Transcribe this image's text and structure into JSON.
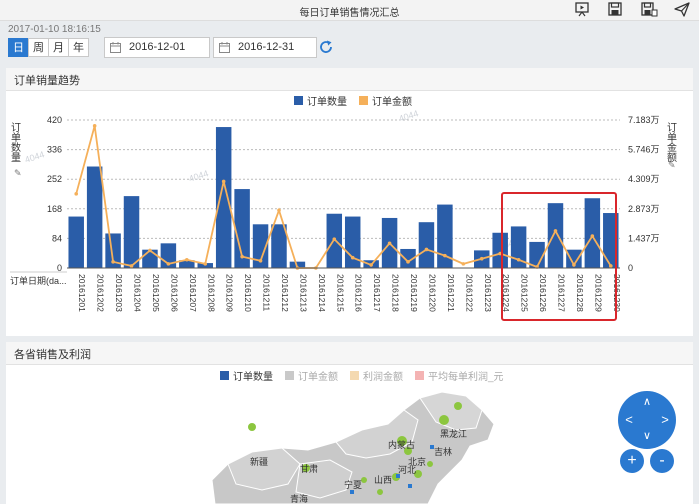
{
  "header": {
    "title": "每日订单销售情况汇总"
  },
  "toolbar": {
    "timestamp": "2017-01-10 18:16:15"
  },
  "period_buttons": [
    "日",
    "周",
    "月",
    "年"
  ],
  "date_range": {
    "start": "2016-12-01",
    "end": "2016-12-31"
  },
  "trend_panel": {
    "title": "订单销量趋势"
  },
  "chart_data": {
    "type": "bar",
    "legend": [
      "订单数量",
      "订单金额"
    ],
    "legend_position": "top",
    "ylabel_left": "订单数量",
    "ylabel_right": "订单金额",
    "xlabel": "订单日期(da...",
    "yticks_left": [
      "420",
      "336",
      "252",
      "168",
      "84",
      "0"
    ],
    "yticks_right": [
      "7.183万",
      "5.746万",
      "4.309万",
      "2.873万",
      "1.437万",
      "0"
    ],
    "ylim_left": [
      0,
      420
    ],
    "ylim_right": [
      0,
      7.183
    ],
    "categories": [
      "20161201",
      "20161202",
      "20161203",
      "20161204",
      "20161205",
      "20161206",
      "20161207",
      "20161208",
      "20161209",
      "20161210",
      "20161211",
      "20161212",
      "20161213",
      "20161214",
      "20161215",
      "20161216",
      "20161217",
      "20161218",
      "20161219",
      "20161220",
      "20161221",
      "20161222",
      "20161223",
      "20161224",
      "20161225",
      "20161226",
      "20161227",
      "20161228",
      "20161229",
      "20161230"
    ],
    "series": [
      {
        "name": "订单数量",
        "type": "bar",
        "axis": "left",
        "color": "#2a5da8",
        "values": [
          146,
          288,
          98,
          204,
          52,
          70,
          22,
          14,
          400,
          224,
          124,
          124,
          18,
          0,
          154,
          146,
          22,
          142,
          54,
          130,
          180,
          0,
          50,
          100,
          118,
          74,
          184,
          52,
          198,
          156
        ]
      },
      {
        "name": "订单金额",
        "type": "line",
        "axis": "right",
        "color": "#f5b05a",
        "values": [
          3.6,
          6.9,
          0.3,
          0.1,
          0.85,
          0.2,
          0.4,
          0.2,
          4.2,
          0.55,
          0.35,
          2.8,
          0.0,
          0.0,
          1.4,
          0.5,
          0.15,
          1.2,
          0.3,
          0.9,
          0.6,
          0.2,
          0.45,
          0.7,
          0.4,
          0.05,
          1.8,
          0.15,
          1.55,
          0.1
        ]
      }
    ],
    "grid": true
  },
  "province_panel": {
    "title": "各省销售及利润",
    "legend": [
      "订单数量",
      "订单金额",
      "利润金额",
      "平均每单利润_元"
    ],
    "legend_colors": [
      "#2a5da8",
      "#c9c9c9",
      "#f4d9b0",
      "#f4b3b3"
    ],
    "labels": [
      "黑龙江",
      "内蒙古",
      "吉林",
      "新疆",
      "甘肃",
      "宁夏",
      "山西",
      "河北",
      "北京",
      "青海"
    ]
  },
  "map_nav": {
    "up": "∧",
    "down": "∨",
    "left": "<",
    "right": ">",
    "zoom_in": "+",
    "zoom_out": "-"
  },
  "watermark": "4044"
}
